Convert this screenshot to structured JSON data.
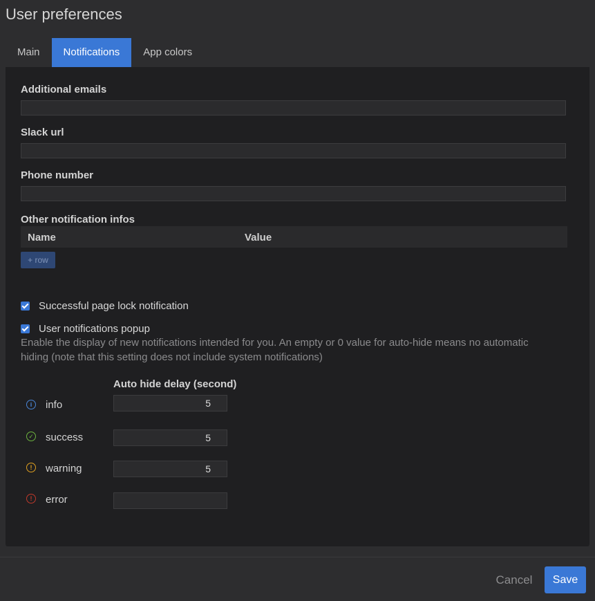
{
  "dialog": {
    "title": "User preferences"
  },
  "tabs": [
    {
      "label": "Main"
    },
    {
      "label": "Notifications"
    },
    {
      "label": "App colors"
    }
  ],
  "form": {
    "additional_emails": {
      "label": "Additional emails",
      "value": ""
    },
    "slack_url": {
      "label": "Slack url",
      "value": ""
    },
    "phone_number": {
      "label": "Phone number",
      "value": ""
    },
    "other_infos": {
      "label": "Other notification infos",
      "columns": [
        "Name",
        "Value"
      ],
      "add_row_label": "+ row"
    },
    "page_lock": {
      "label": "Successful page lock notification",
      "checked": true
    },
    "popup": {
      "label": "User notifications popup",
      "checked": true,
      "help": "Enable the display of new notifications intended for you. An empty or 0 value for auto-hide means no automatic hiding (note that this setting does not include system notifications)"
    },
    "auto_hide": {
      "header": "Auto hide delay (second)",
      "levels": [
        {
          "name": "info",
          "value": "5",
          "icon": "info-icon",
          "color": "#4a86d8"
        },
        {
          "name": "success",
          "value": "5",
          "icon": "check-circle-icon",
          "color": "#6db33f"
        },
        {
          "name": "warning",
          "value": "5",
          "icon": "warning-icon",
          "color": "#e0a020"
        },
        {
          "name": "error",
          "value": "",
          "icon": "error-icon",
          "color": "#c0392b"
        }
      ]
    }
  },
  "footer": {
    "cancel_label": "Cancel",
    "save_label": "Save"
  }
}
